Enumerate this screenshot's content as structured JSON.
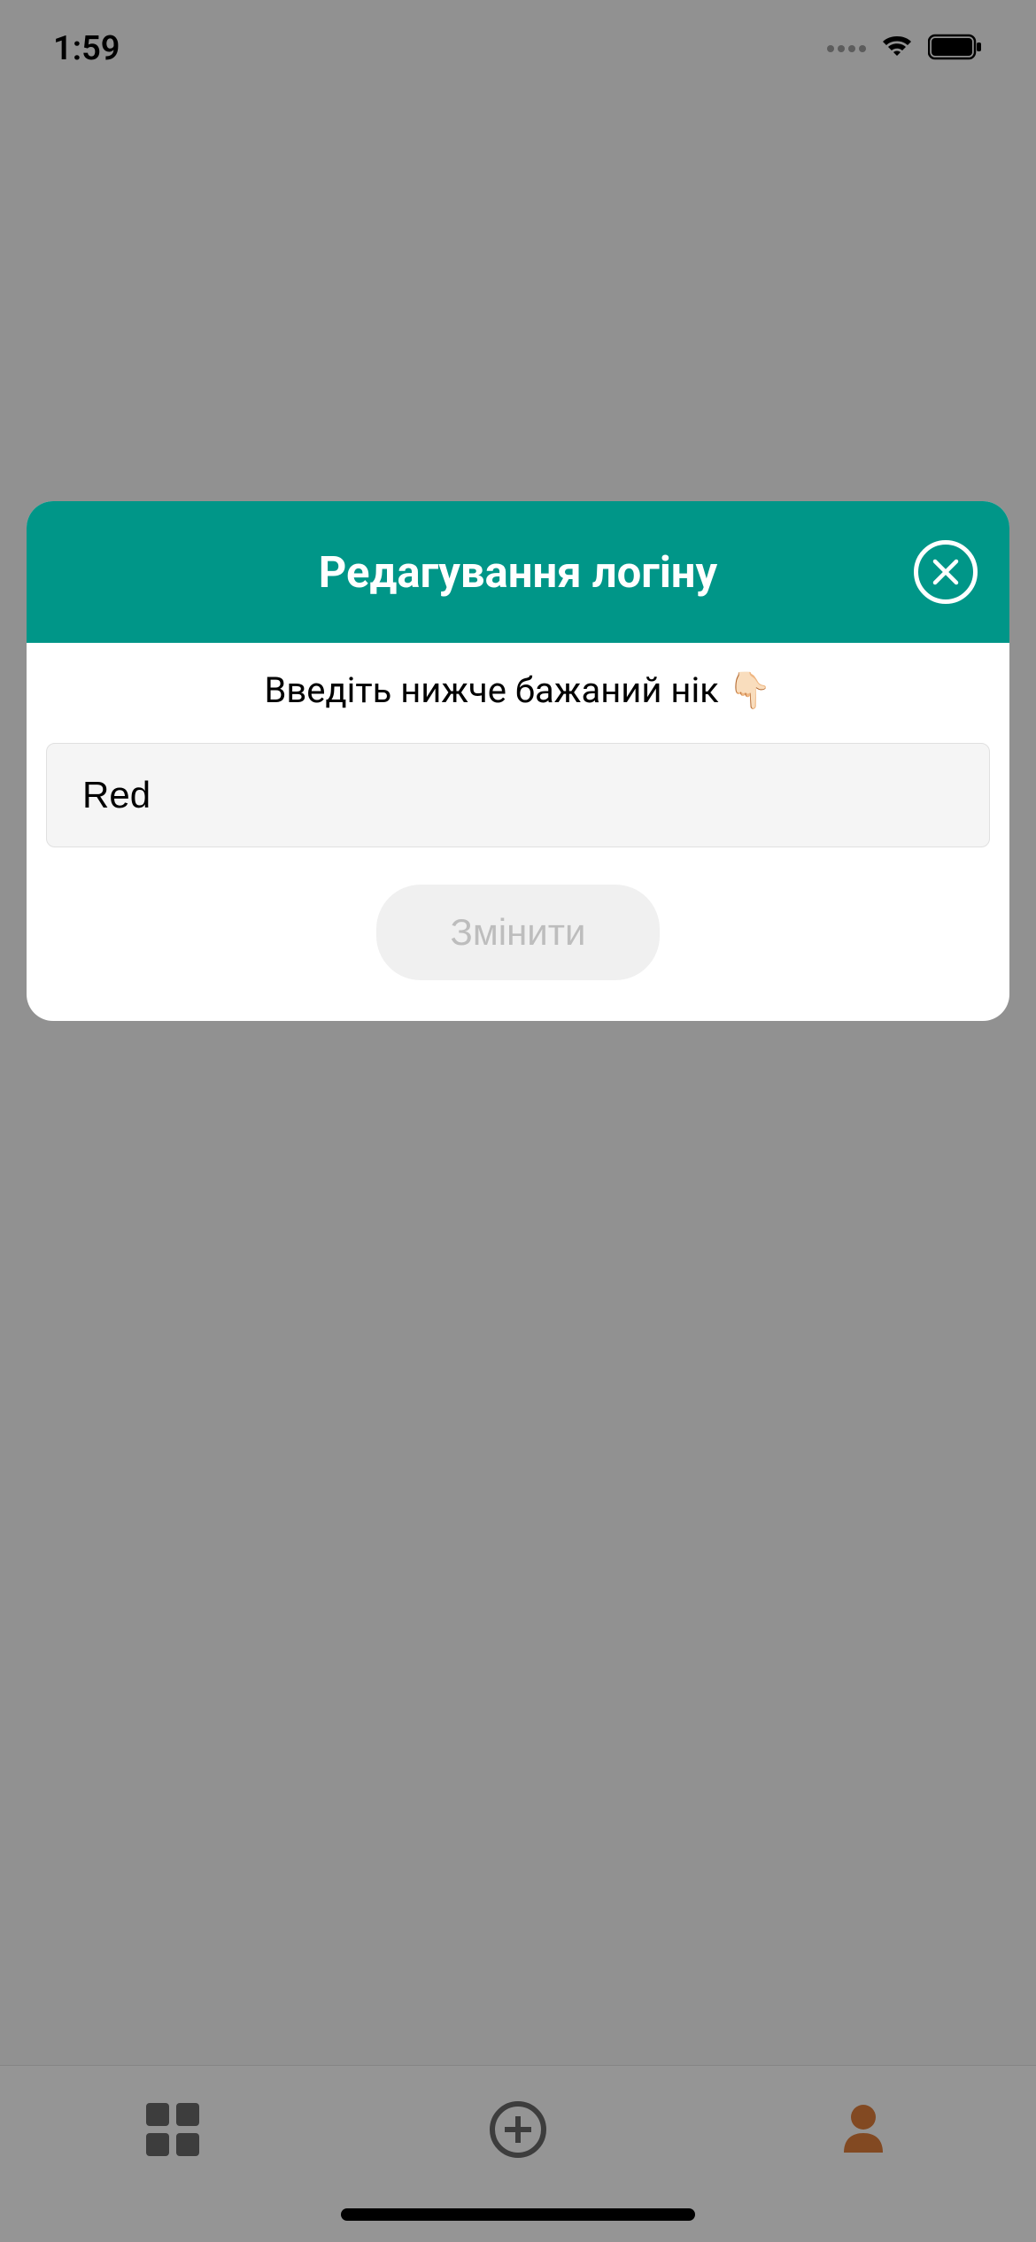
{
  "statusBar": {
    "time": "1:59"
  },
  "modal": {
    "title": "Редагування логіну",
    "instruction": "Введіть нижче бажаний нік 👇🏻",
    "inputValue": "Red",
    "submitLabel": "Змінити"
  },
  "colors": {
    "teal": "#009688",
    "accent": "#d97b3a"
  }
}
